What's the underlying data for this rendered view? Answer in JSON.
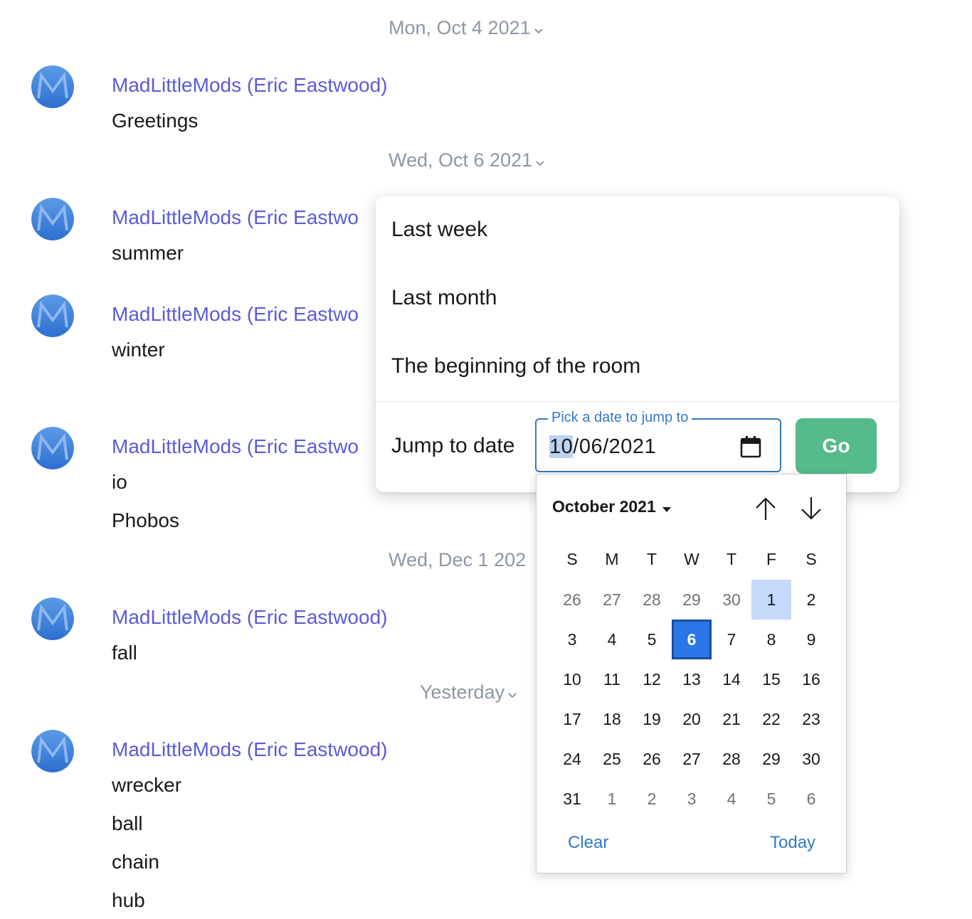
{
  "timeline": {
    "dates": [
      {
        "label": "Mon, Oct 4 2021"
      },
      {
        "label": "Wed, Oct 6 2021"
      },
      {
        "label": "Wed, Dec 1 202"
      },
      {
        "label": "Yesterday"
      }
    ],
    "sender_name": "MadLittleMods (Eric Eastwood)",
    "sender_truncated": "MadLittleMods (Eric Eastwo",
    "messages": {
      "m1": "Greetings",
      "m2": "summer",
      "m3": "winter",
      "m4a": "io",
      "m4b": "Phobos",
      "m5": "fall",
      "m6a": "wrecker",
      "m6b": "ball",
      "m6c": "chain",
      "m6d": "hub"
    }
  },
  "jump_menu": {
    "options": [
      "Last week",
      "Last month",
      "The beginning of the room"
    ],
    "jump_label": "Jump to date",
    "field_legend": "Pick a date to jump to",
    "field_value_month": "10",
    "field_value_rest": "/06/2021",
    "go_label": "Go"
  },
  "calendar": {
    "month_label": "October 2021",
    "weekdays": [
      "S",
      "M",
      "T",
      "W",
      "T",
      "F",
      "S"
    ],
    "weeks": [
      [
        "26",
        "27",
        "28",
        "29",
        "30",
        "1",
        "2"
      ],
      [
        "3",
        "4",
        "5",
        "6",
        "7",
        "8",
        "9"
      ],
      [
        "10",
        "11",
        "12",
        "13",
        "14",
        "15",
        "16"
      ],
      [
        "17",
        "18",
        "19",
        "20",
        "21",
        "22",
        "23"
      ],
      [
        "24",
        "25",
        "26",
        "27",
        "28",
        "29",
        "30"
      ],
      [
        "31",
        "1",
        "2",
        "3",
        "4",
        "5",
        "6"
      ]
    ],
    "clear_label": "Clear",
    "today_label": "Today"
  },
  "colors": {
    "accent": "#5b5bd6",
    "go": "#55bb8a",
    "link": "#3578c6",
    "selected": "#2a76e8"
  }
}
